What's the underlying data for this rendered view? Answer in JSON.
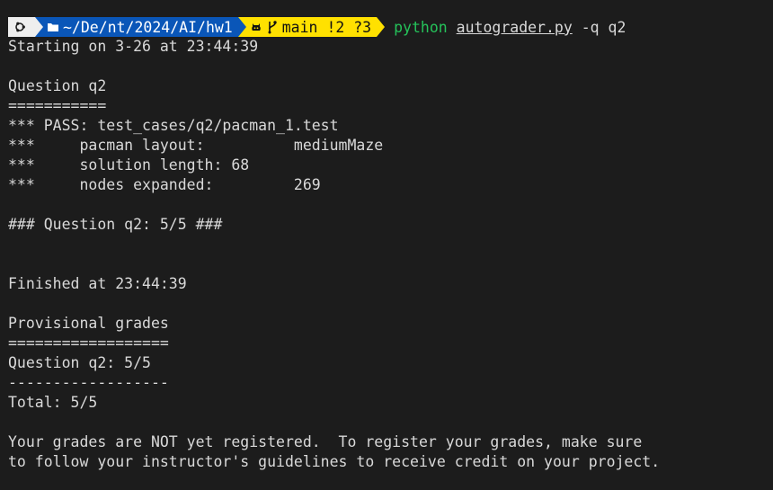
{
  "prompt": {
    "directory": "~/De/nt/2024/AI/hw1",
    "git_branch": "main",
    "git_status": "!2 ?3",
    "command_program": "python",
    "command_file": "autograder.py",
    "command_args": "-q q2"
  },
  "output": {
    "line_01": "Starting on 3-26 at 23:44:39",
    "line_02": "",
    "line_03": "Question q2",
    "line_04": "===========",
    "line_05": "*** PASS: test_cases/q2/pacman_1.test",
    "line_06": "***     pacman layout:          mediumMaze",
    "line_07": "***     solution length: 68",
    "line_08": "***     nodes expanded:         269",
    "line_09": "",
    "line_10": "### Question q2: 5/5 ###",
    "line_11": "",
    "line_12": "",
    "line_13": "Finished at 23:44:39",
    "line_14": "",
    "line_15": "Provisional grades",
    "line_16": "==================",
    "line_17": "Question q2: 5/5",
    "line_18": "------------------",
    "line_19": "Total: 5/5",
    "line_20": "",
    "line_21": "Your grades are NOT yet registered.  To register your grades, make sure",
    "line_22": "to follow your instructor's guidelines to receive credit on your project."
  },
  "icons": {
    "os": "ubuntu-icon",
    "folder": "folder-icon",
    "github": "github-icon",
    "branch": "git-branch-icon"
  },
  "colors": {
    "background": "#1c1c1c",
    "foreground": "#d9d9d9",
    "segment_os": "#eeeeee",
    "segment_dir": "#0a56b8",
    "segment_git": "#ffe100",
    "command_program": "#25c25a"
  }
}
